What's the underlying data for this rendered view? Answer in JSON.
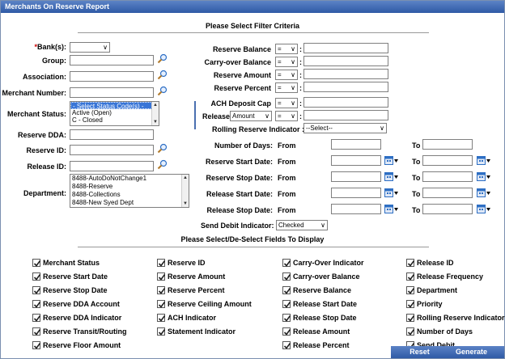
{
  "window": {
    "title": "Merchants On Reserve Report"
  },
  "headers": {
    "filter": "Please Select Filter Criteria",
    "fields": "Please Select/De-Select Fields To Display"
  },
  "left_form": {
    "bank_label": "Bank(s):",
    "bank_required_mark": "*",
    "group_label": "Group:",
    "association_label": "Association:",
    "merchant_number_label": "Merchant Number:",
    "merchant_status_label": "Merchant Status:",
    "merchant_status_options": [
      "- Select Status Code(s) -",
      "Active (Open)",
      "C - Closed"
    ],
    "reserve_dda_label": "Reserve DDA:",
    "reserve_id_label": "Reserve ID:",
    "release_id_label": "Release ID:",
    "department_label": "Department:",
    "department_options": [
      "8488-AutoDoNotChange1",
      "8488-Reserve",
      "8488-Collections",
      "8488-New Syed Dept"
    ]
  },
  "right_form": {
    "operator_value": "=",
    "reserve_balance_label": "Reserve Balance",
    "carryover_balance_label": "Carry-over Balance",
    "reserve_amount_label": "Reserve Amount",
    "reserve_percent_label": "Reserve Percent",
    "ach_deposit_cap_label": "ACH Deposit Cap",
    "release_label": "Release",
    "release_field_value": "Amount",
    "rolling_reserve_label": "Rolling Reserve Indicator :",
    "rolling_reserve_value": "--Select--",
    "number_of_days_label": "Number of Days:",
    "reserve_start_date_label": "Reserve Start Date:",
    "reserve_stop_date_label": "Reserve Stop Date:",
    "release_start_date_label": "Release Start Date:",
    "release_stop_date_label": "Release Stop Date:",
    "from_label": "From",
    "to_label": "To",
    "send_debit_indicator_label": "Send Debit Indicator:",
    "send_debit_indicator_value": "Checked",
    "colon": ":"
  },
  "fields": {
    "col1": [
      "Merchant Status",
      "Reserve Start Date",
      "Reserve Stop Date",
      "Reserve DDA Account",
      "Reserve DDA Indicator",
      "Reserve Transit/Routing",
      "Reserve Floor Amount"
    ],
    "col2": [
      "Reserve ID",
      "Reserve Amount",
      "Reserve Percent",
      "Reserve Ceiling Amount",
      "ACH Indicator",
      "Statement Indicator"
    ],
    "col3": [
      "Carry-Over Indicator",
      "Carry-over Balance",
      "Reserve Balance",
      "Release Start Date",
      "Release Stop Date",
      "Release Amount",
      "Release Percent"
    ],
    "col4": [
      "Release ID",
      "Release Frequency",
      "Department",
      "Priority",
      "Rolling Reserve Indicator",
      "Number of Days",
      "Send Debit"
    ]
  },
  "buttons": {
    "reset": "Reset",
    "generate": "Generate"
  },
  "colors": {
    "titlebar": "#3a65b0",
    "accent": "#4a6fb0",
    "selected": "#3875d7"
  }
}
